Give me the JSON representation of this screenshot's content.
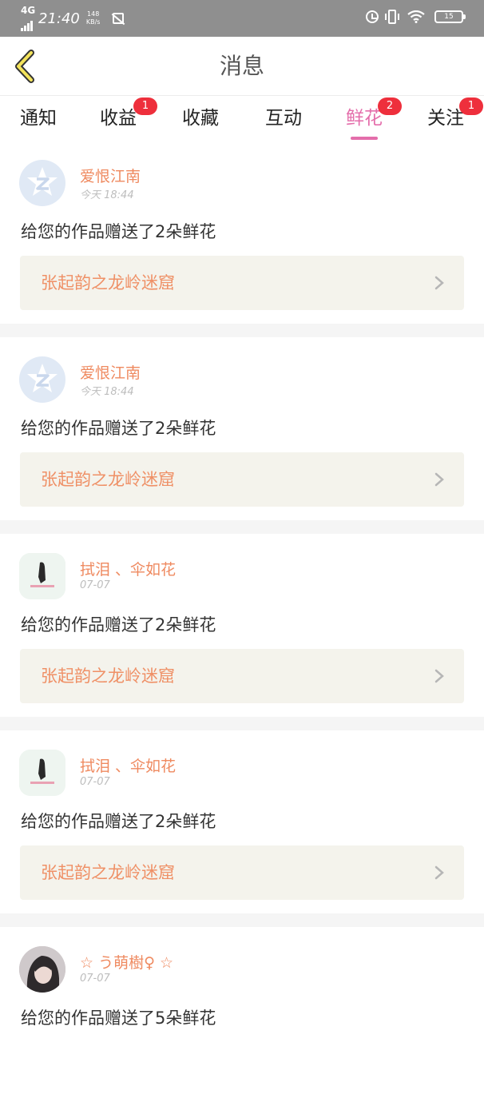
{
  "status_bar": {
    "network": "4G",
    "time": "21:40",
    "speed_value": "148",
    "speed_unit": "KB/s",
    "battery": "15"
  },
  "header": {
    "title": "消息"
  },
  "tabs": [
    {
      "label": "通知",
      "badge": ""
    },
    {
      "label": "收益",
      "badge": "1"
    },
    {
      "label": "收藏",
      "badge": ""
    },
    {
      "label": "互动",
      "badge": ""
    },
    {
      "label": "鲜花",
      "badge": "2",
      "active": true
    },
    {
      "label": "关注",
      "badge": "1"
    }
  ],
  "colors": {
    "accent": "#e46eab",
    "name": "#ef8a60",
    "badge": "#ee2f3c",
    "work_bg": "#f4f3ec"
  },
  "messages": [
    {
      "name": "爱恨江南",
      "time": "今天 18:44",
      "text": "给您的作品赠送了2朵鲜花",
      "work": "张起韵之龙岭迷窟",
      "avatar": "qq-avatar-icon"
    },
    {
      "name": "爱恨江南",
      "time": "今天 18:44",
      "text": "给您的作品赠送了2朵鲜花",
      "work": "张起韵之龙岭迷窟",
      "avatar": "qq-avatar-icon"
    },
    {
      "name": "拭泪 、伞如花",
      "time": "07-07",
      "text": "给您的作品赠送了2朵鲜花",
      "work": "张起韵之龙岭迷窟",
      "avatar": "photo"
    },
    {
      "name": "拭泪 、伞如花",
      "time": "07-07",
      "text": "给您的作品赠送了2朵鲜花",
      "work": "张起韵之龙岭迷窟",
      "avatar": "photo"
    },
    {
      "name": "☆ う萌樹♀ ☆",
      "time": "07-07",
      "text": "给您的作品赠送了5朵鲜花",
      "work": "",
      "avatar": "photo"
    }
  ]
}
